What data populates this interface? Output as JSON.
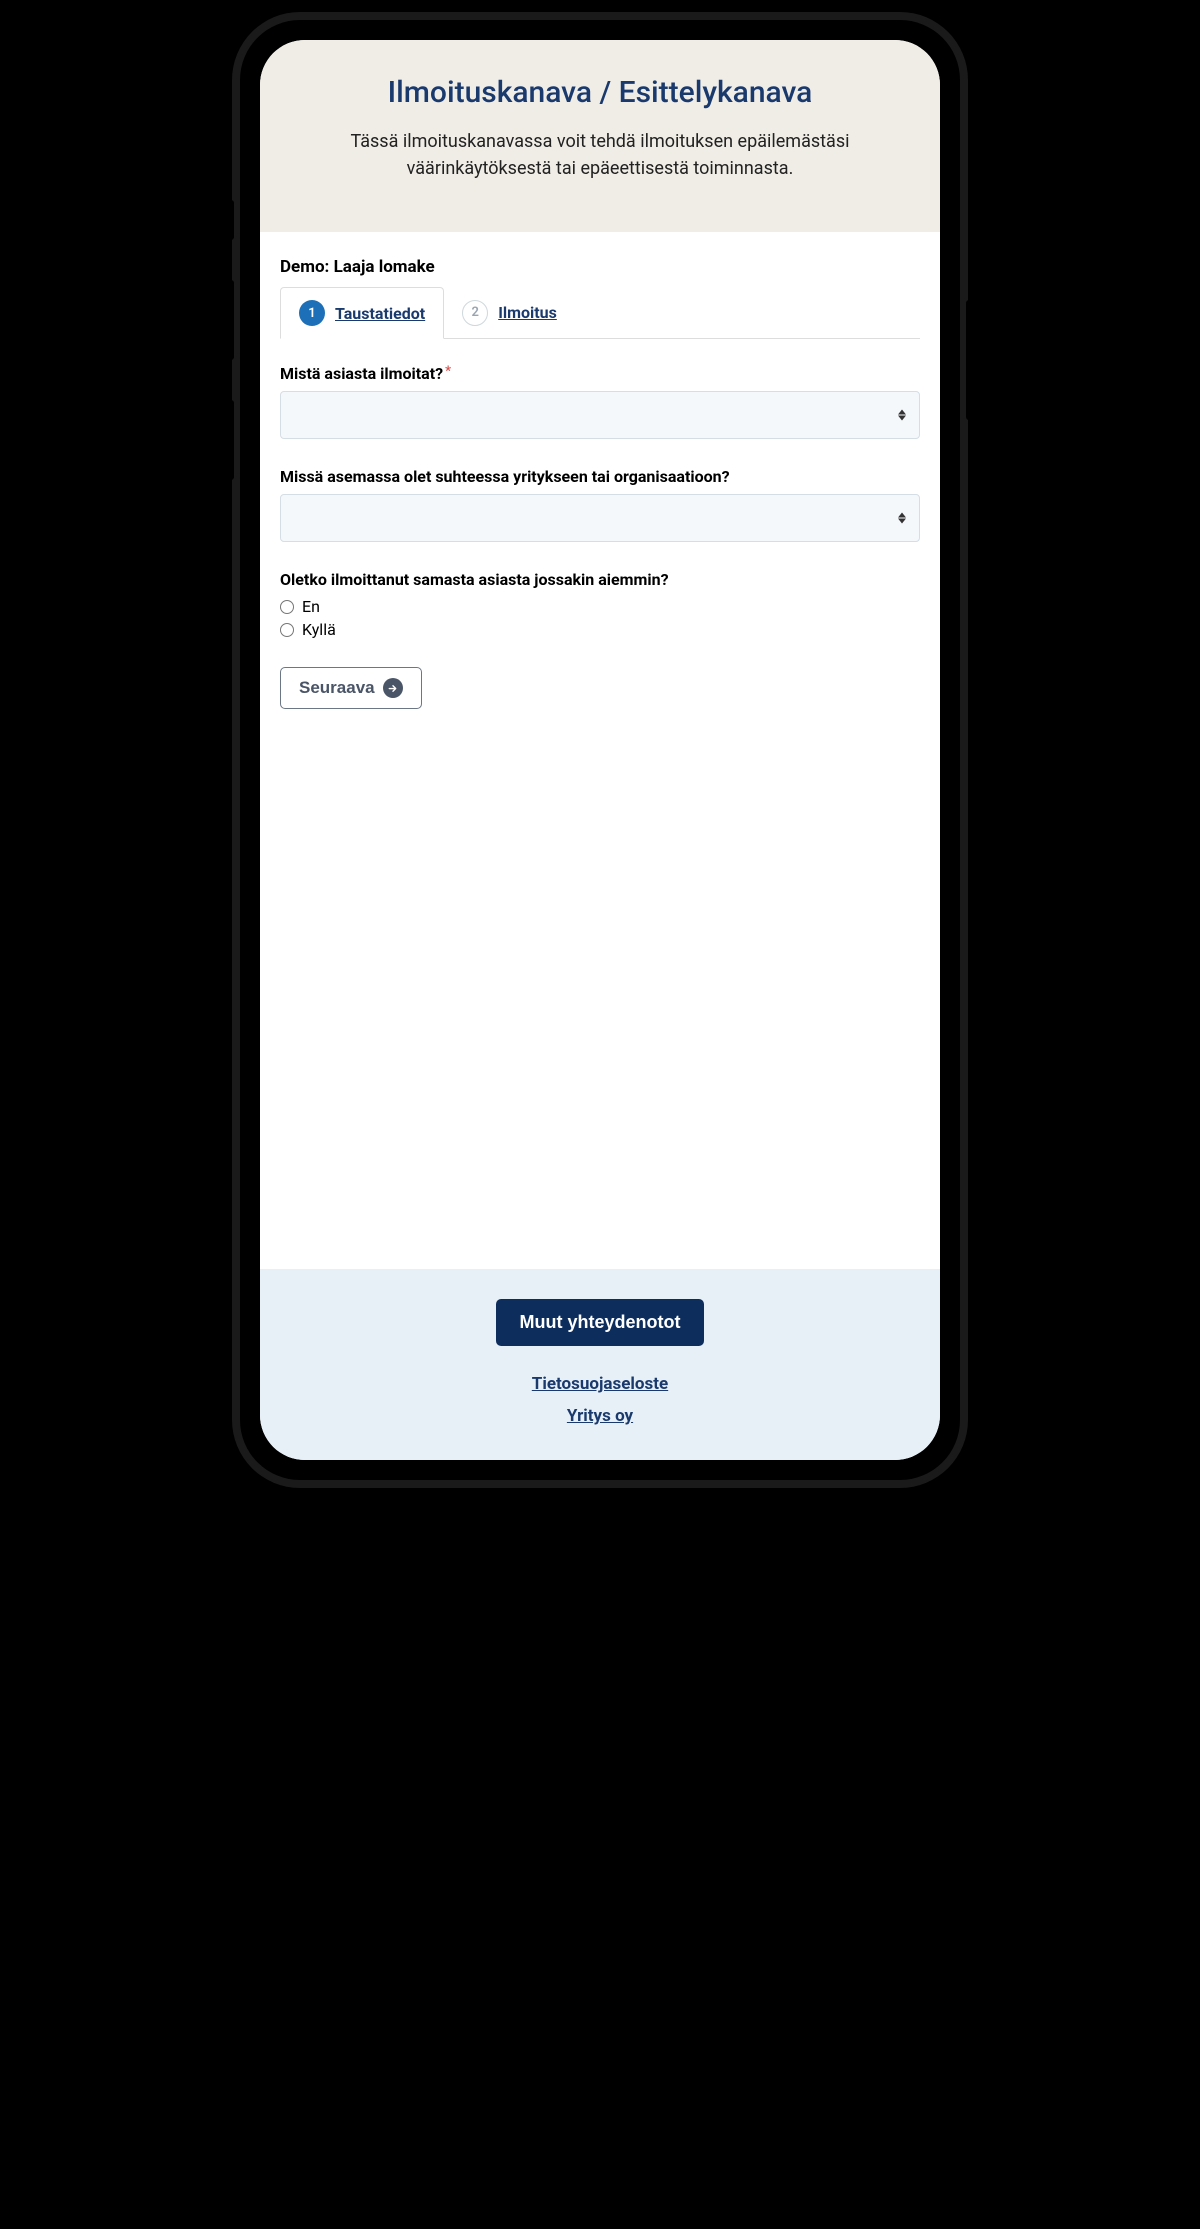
{
  "header": {
    "title": "Ilmoituskanava / Esittelykanava",
    "subtitle": "Tässä ilmoituskanavassa voit tehdä ilmoituksen epäilemästäsi väärinkäytöksestä tai epäeettisestä toiminnasta."
  },
  "form": {
    "heading": "Demo: Laaja lomake",
    "tabs": [
      {
        "number": "1",
        "label": "Taustatiedot",
        "active": true
      },
      {
        "number": "2",
        "label": "Ilmoitus",
        "active": false
      }
    ],
    "questions": {
      "q1_label": "Mistä asiasta ilmoitat?",
      "q2_label": "Missä asemassa olet suhteessa yritykseen tai organisaatioon?",
      "q3_label": "Oletko ilmoittanut samasta asiasta jossakin aiemmin?",
      "radio_options": {
        "no": "En",
        "yes": "Kyllä"
      }
    },
    "next_button": "Seuraava"
  },
  "footer": {
    "contact_button": "Muut yhteydenotot",
    "privacy_link": "Tietosuojaseloste",
    "company_link": "Yritys oy"
  }
}
